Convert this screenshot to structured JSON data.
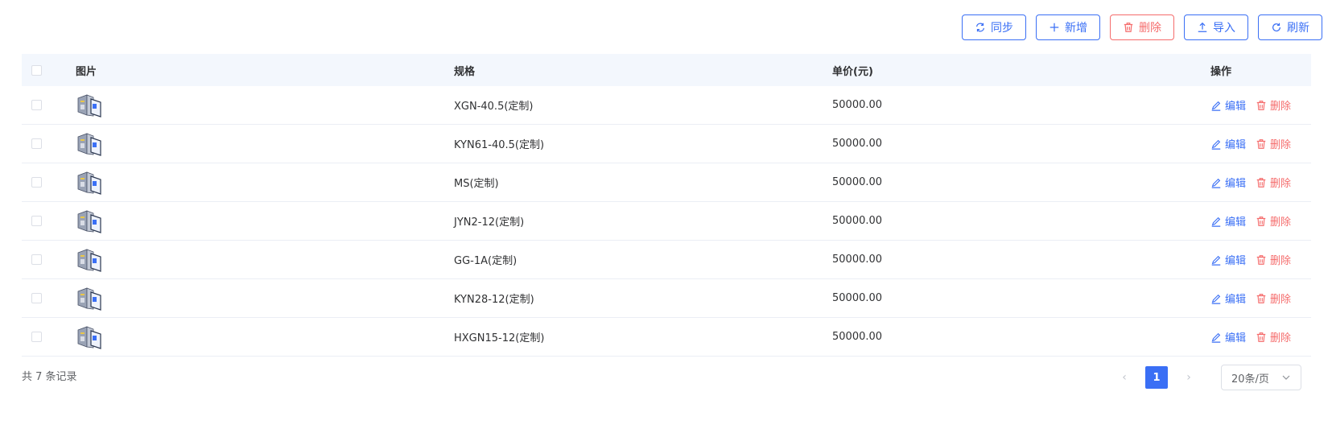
{
  "toolbar": {
    "sync_label": "同步",
    "add_label": "新增",
    "delete_label": "删除",
    "import_label": "导入",
    "refresh_label": "刷新"
  },
  "table": {
    "columns": {
      "image": "图片",
      "spec": "规格",
      "price": "单价(元)",
      "ops": "操作"
    },
    "rows": [
      {
        "spec": "XGN-40.5(定制)",
        "price": "50000.00"
      },
      {
        "spec": "KYN61-40.5(定制)",
        "price": "50000.00"
      },
      {
        "spec": "MS(定制)",
        "price": "50000.00"
      },
      {
        "spec": "JYN2-12(定制)",
        "price": "50000.00"
      },
      {
        "spec": "GG-1A(定制)",
        "price": "50000.00"
      },
      {
        "spec": "KYN28-12(定制)",
        "price": "50000.00"
      },
      {
        "spec": "HXGN15-12(定制)",
        "price": "50000.00"
      }
    ],
    "edit_label": "编辑",
    "delete_label": "删除"
  },
  "footer": {
    "total_text": "共 7 条记录",
    "current_page": "1",
    "page_size": "20条/页"
  },
  "colors": {
    "primary": "#3a6ff5",
    "danger": "#f56c6c",
    "header_bg": "#f3f7fd"
  }
}
